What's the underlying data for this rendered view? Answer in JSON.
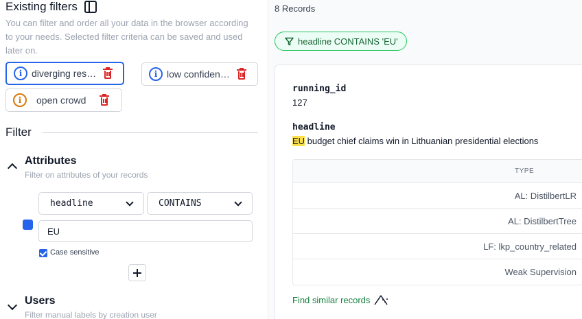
{
  "existing_filters": {
    "title": "Existing filters",
    "description": "You can filter and order all your data in the browser according to your needs. Selected filter criteria can be saved and used later on.",
    "chips": [
      {
        "label": "diverging res…",
        "icon": "info-icon"
      },
      {
        "label": "low confiden…",
        "icon": "info-icon"
      },
      {
        "label": "open crowd",
        "icon": "warning-info-icon"
      }
    ]
  },
  "filter": {
    "heading": "Filter",
    "attributes": {
      "title": "Attributes",
      "subtitle": "Filter on attributes of your records",
      "field_value": "headline",
      "operator_value": "CONTAINS",
      "search_value": "EU",
      "case_sensitive_label": "Case sensitive",
      "case_sensitive_checked": true,
      "color": "#2563eb"
    },
    "users": {
      "title": "Users",
      "subtitle": "Filter manual labels by creation user"
    }
  },
  "records": {
    "count_label": "8 Records",
    "active_filter": "headline CONTAINS 'EU'",
    "card": {
      "field1_name": "running_id",
      "field1_value": "127",
      "field2_name": "headline",
      "headline_highlight": "EU",
      "headline_rest": " budget chief claims win in Lithuanian presidential elections",
      "table_header": "TYPE",
      "table_rows": [
        "AL: DistilbertLR",
        "AL: DistilbertTree",
        "LF: lkp_country_related",
        "Weak Supervision"
      ],
      "find_similar": "Find similar records"
    }
  }
}
